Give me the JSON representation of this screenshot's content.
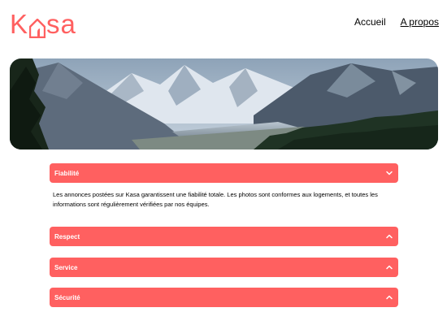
{
  "brand": {
    "logo_prefix": "K",
    "logo_suffix": "sa",
    "color": "#ff6060"
  },
  "nav": {
    "items": [
      {
        "label": "Accueil",
        "active": false
      },
      {
        "label": "A propos",
        "active": true
      }
    ]
  },
  "banner": {
    "icon": "mountain-landscape-image"
  },
  "sections": [
    {
      "title": "Fiabilité",
      "expanded": true,
      "text": "Les annonces postées sur Kasa garantissent une fiabilité totale. Les photos sont conformes aux logements, et toutes les informations sont régulièrement vérifiées par nos équipes."
    },
    {
      "title": "Respect",
      "expanded": false
    },
    {
      "title": "Service",
      "expanded": false
    },
    {
      "title": "Sécurité",
      "expanded": false
    }
  ]
}
